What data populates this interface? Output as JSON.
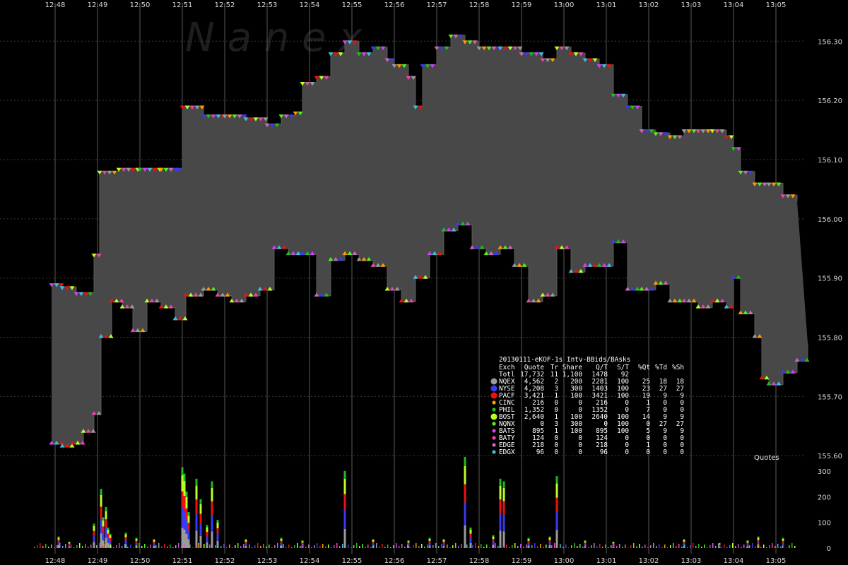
{
  "chart_data": [
    {
      "type": "area",
      "watermark": "N a n e x",
      "title": "20130111-eKOF-1s Intv-BBids/BAsks",
      "panel_label": "Quotes",
      "x_ticks": [
        "12:48",
        "12:49",
        "12:50",
        "12:51",
        "12:52",
        "12:53",
        "12:54",
        "12:55",
        "12:56",
        "12:57",
        "12:58",
        "12:59",
        "13:00",
        "13:01",
        "13:02",
        "13:03",
        "13:04",
        "13:05"
      ],
      "y_ticks": [
        "156.30",
        "156.20",
        "156.10",
        "156.00",
        "155.90",
        "155.80",
        "155.70",
        "155.60"
      ],
      "ylim": [
        155.58,
        156.36
      ],
      "fill_color": "#484848",
      "series": [
        {
          "name": "Best Ask",
          "values": [
            [
              "12:47:55",
              155.89
            ],
            [
              "12:48:10",
              155.885
            ],
            [
              "12:48:30",
              155.875
            ],
            [
              "12:48:50",
              155.875
            ],
            [
              "12:48:55",
              155.94
            ],
            [
              "12:49:03",
              156.08
            ],
            [
              "12:49:30",
              156.085
            ],
            [
              "12:49:50",
              156.085
            ],
            [
              "12:50:00",
              156.085
            ],
            [
              "12:50:30",
              156.085
            ],
            [
              "12:50:55",
              156.085
            ],
            [
              "12:51:00",
              156.19
            ],
            [
              "12:51:30",
              156.175
            ],
            [
              "12:52:00",
              156.175
            ],
            [
              "12:52:30",
              156.17
            ],
            [
              "12:53:00",
              156.16
            ],
            [
              "12:53:20",
              156.175
            ],
            [
              "12:53:40",
              156.18
            ],
            [
              "12:53:50",
              156.23
            ],
            [
              "12:54:10",
              156.24
            ],
            [
              "12:54:30",
              156.28
            ],
            [
              "12:54:50",
              156.3
            ],
            [
              "12:55:10",
              156.28
            ],
            [
              "12:55:30",
              156.29
            ],
            [
              "12:55:50",
              156.27
            ],
            [
              "12:56:00",
              156.26
            ],
            [
              "12:56:20",
              156.24
            ],
            [
              "12:56:30",
              156.19
            ],
            [
              "12:56:40",
              156.26
            ],
            [
              "12:57:00",
              156.29
            ],
            [
              "12:57:20",
              156.31
            ],
            [
              "12:57:40",
              156.3
            ],
            [
              "12:58:00",
              156.29
            ],
            [
              "12:58:30",
              156.29
            ],
            [
              "12:59:00",
              156.28
            ],
            [
              "12:59:30",
              156.27
            ],
            [
              "12:59:50",
              156.29
            ],
            [
              "13:00:10",
              156.28
            ],
            [
              "13:00:30",
              156.27
            ],
            [
              "13:00:50",
              156.26
            ],
            [
              "13:01:10",
              156.21
            ],
            [
              "13:01:30",
              156.19
            ],
            [
              "13:01:50",
              156.15
            ],
            [
              "13:02:10",
              156.145
            ],
            [
              "13:02:30",
              156.14
            ],
            [
              "13:02:50",
              156.15
            ],
            [
              "13:03:10",
              156.15
            ],
            [
              "13:03:30",
              156.15
            ],
            [
              "13:03:50",
              156.14
            ],
            [
              "13:04:00",
              156.12
            ],
            [
              "13:04:10",
              156.08
            ],
            [
              "13:04:30",
              156.06
            ],
            [
              "13:04:50",
              156.06
            ],
            [
              "13:05:10",
              156.04
            ],
            [
              "13:05:30",
              156.03
            ]
          ]
        },
        {
          "name": "Best Bid",
          "values": [
            [
              "12:47:55",
              155.62
            ],
            [
              "12:48:10",
              155.615
            ],
            [
              "12:48:25",
              155.62
            ],
            [
              "12:48:40",
              155.64
            ],
            [
              "12:48:55",
              155.67
            ],
            [
              "12:49:05",
              155.8
            ],
            [
              "12:49:20",
              155.86
            ],
            [
              "12:49:35",
              155.85
            ],
            [
              "12:49:50",
              155.81
            ],
            [
              "12:50:10",
              155.86
            ],
            [
              "12:50:30",
              155.85
            ],
            [
              "12:50:50",
              155.83
            ],
            [
              "12:51:05",
              155.87
            ],
            [
              "12:51:30",
              155.88
            ],
            [
              "12:51:50",
              155.87
            ],
            [
              "12:52:10",
              155.86
            ],
            [
              "12:52:30",
              155.87
            ],
            [
              "12:52:50",
              155.88
            ],
            [
              "12:53:10",
              155.95
            ],
            [
              "12:53:30",
              155.94
            ],
            [
              "12:53:50",
              155.94
            ],
            [
              "12:54:10",
              155.87
            ],
            [
              "12:54:30",
              155.93
            ],
            [
              "12:54:50",
              155.94
            ],
            [
              "12:55:10",
              155.93
            ],
            [
              "12:55:30",
              155.92
            ],
            [
              "12:55:50",
              155.88
            ],
            [
              "12:56:10",
              155.86
            ],
            [
              "12:56:30",
              155.9
            ],
            [
              "12:56:50",
              155.94
            ],
            [
              "12:57:10",
              155.98
            ],
            [
              "12:57:30",
              155.99
            ],
            [
              "12:57:50",
              155.95
            ],
            [
              "12:58:10",
              155.94
            ],
            [
              "12:58:30",
              155.95
            ],
            [
              "12:58:50",
              155.92
            ],
            [
              "12:59:10",
              155.86
            ],
            [
              "12:59:30",
              155.87
            ],
            [
              "12:59:50",
              155.95
            ],
            [
              "13:00:10",
              155.91
            ],
            [
              "13:00:30",
              155.92
            ],
            [
              "13:00:50",
              155.92
            ],
            [
              "13:01:10",
              155.96
            ],
            [
              "13:01:30",
              155.88
            ],
            [
              "13:01:50",
              155.88
            ],
            [
              "13:02:10",
              155.89
            ],
            [
              "13:02:30",
              155.86
            ],
            [
              "13:02:50",
              155.86
            ],
            [
              "13:03:10",
              155.85
            ],
            [
              "13:03:30",
              155.86
            ],
            [
              "13:03:50",
              155.85
            ],
            [
              "13:04:00",
              155.9
            ],
            [
              "13:04:10",
              155.84
            ],
            [
              "13:04:30",
              155.8
            ],
            [
              "13:04:40",
              155.73
            ],
            [
              "13:04:50",
              155.72
            ],
            [
              "13:05:10",
              155.74
            ],
            [
              "13:05:30",
              155.76
            ],
            [
              "13:05:45",
              155.79
            ]
          ]
        }
      ],
      "legend": {
        "header": [
          "Exch",
          "Quote",
          "Tr",
          "Share",
          "Q/T",
          "S/T",
          "%Qt",
          "%Td",
          "%Sh"
        ],
        "total": [
          "Totl",
          "17,732",
          "11",
          "1,100",
          "1478",
          "92",
          "",
          "",
          ""
        ],
        "rows": [
          {
            "name": "NQEX",
            "color": "#9a9a9a",
            "marker": "big",
            "values": [
              "4,562",
              "2",
              "200",
              "2281",
              "100",
              "25",
              "18",
              "18"
            ]
          },
          {
            "name": "NYSE",
            "color": "#3a3af0",
            "marker": "big",
            "values": [
              "4,208",
              "3",
              "300",
              "1403",
              "100",
              "23",
              "27",
              "27"
            ]
          },
          {
            "name": "PACF",
            "color": "#ee1111",
            "marker": "big",
            "values": [
              "3,421",
              "1",
              "100",
              "3421",
              "100",
              "19",
              "9",
              "9"
            ]
          },
          {
            "name": "CINC",
            "color": "#ff9900",
            "marker": "small",
            "values": [
              "216",
              "0",
              "0",
              "216",
              "0",
              "1",
              "0",
              "0"
            ]
          },
          {
            "name": "PHIL",
            "color": "#22bb22",
            "marker": "small",
            "values": [
              "1,352",
              "0",
              "0",
              "1352",
              "0",
              "7",
              "0",
              "0"
            ]
          },
          {
            "name": "BOST",
            "color": "#bbff22",
            "marker": "big",
            "values": [
              "2,640",
              "1",
              "100",
              "2640",
              "100",
              "14",
              "9",
              "9"
            ]
          },
          {
            "name": "NQNX",
            "color": "#55ee22",
            "marker": "small",
            "values": [
              "0",
              "3",
              "300",
              "0",
              "100",
              "0",
              "27",
              "27"
            ]
          },
          {
            "name": "BATS",
            "color": "#cc44ee",
            "marker": "small",
            "values": [
              "895",
              "1",
              "100",
              "895",
              "100",
              "5",
              "9",
              "9"
            ]
          },
          {
            "name": "BATY",
            "color": "#ee44aa",
            "marker": "small",
            "values": [
              "124",
              "0",
              "0",
              "124",
              "0",
              "0",
              "0",
              "0"
            ]
          },
          {
            "name": "EDGE",
            "color": "#cc66bb",
            "marker": "small",
            "values": [
              "218",
              "0",
              "0",
              "218",
              "0",
              "1",
              "0",
              "0"
            ]
          },
          {
            "name": "EDGX",
            "color": "#44bbdd",
            "marker": "small",
            "values": [
              "96",
              "0",
              "0",
              "96",
              "0",
              "0",
              "0",
              "0"
            ]
          }
        ]
      }
    },
    {
      "type": "bar",
      "y_ticks": [
        "300",
        "200",
        "100",
        "0"
      ],
      "ylim": [
        0,
        330
      ],
      "bars": [
        [
          "12:48:05",
          45
        ],
        [
          "12:48:20",
          25
        ],
        [
          "12:48:55",
          95
        ],
        [
          "12:49:05",
          230
        ],
        [
          "12:49:08",
          120
        ],
        [
          "12:49:12",
          160
        ],
        [
          "12:49:15",
          80
        ],
        [
          "12:49:18",
          55
        ],
        [
          "12:49:40",
          60
        ],
        [
          "12:49:55",
          40
        ],
        [
          "12:50:20",
          35
        ],
        [
          "12:51:00",
          315
        ],
        [
          "12:51:03",
          290
        ],
        [
          "12:51:06",
          220
        ],
        [
          "12:51:09",
          140
        ],
        [
          "12:51:20",
          270
        ],
        [
          "12:51:26",
          190
        ],
        [
          "12:51:35",
          90
        ],
        [
          "12:51:42",
          260
        ],
        [
          "12:51:50",
          110
        ],
        [
          "12:52:30",
          35
        ],
        [
          "12:53:20",
          40
        ],
        [
          "12:53:50",
          30
        ],
        [
          "12:54:50",
          300
        ],
        [
          "12:55:30",
          35
        ],
        [
          "12:56:20",
          30
        ],
        [
          "12:56:50",
          40
        ],
        [
          "12:57:10",
          35
        ],
        [
          "12:57:40",
          355
        ],
        [
          "12:57:48",
          80
        ],
        [
          "12:58:20",
          50
        ],
        [
          "12:58:30",
          270
        ],
        [
          "12:58:35",
          260
        ],
        [
          "12:59:10",
          40
        ],
        [
          "12:59:40",
          45
        ],
        [
          "12:59:50",
          280
        ],
        [
          "13:00:30",
          30
        ],
        [
          "13:01:10",
          25
        ],
        [
          "13:02:50",
          35
        ],
        [
          "13:03:40",
          20
        ],
        [
          "13:04:20",
          30
        ],
        [
          "13:04:35",
          45
        ],
        [
          "13:05:10",
          40
        ]
      ]
    }
  ]
}
